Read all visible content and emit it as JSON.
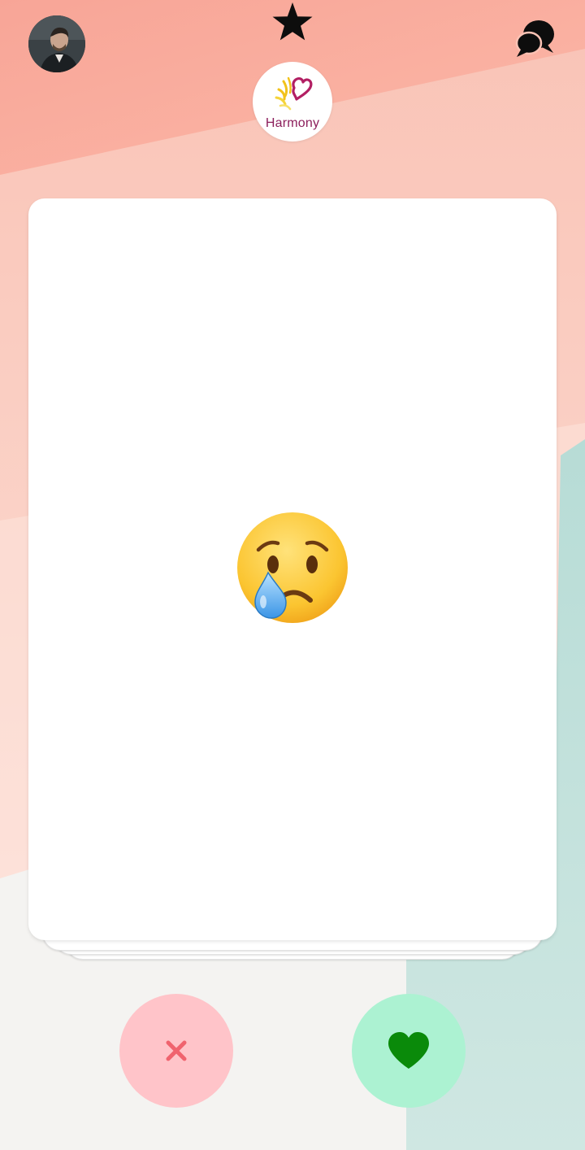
{
  "header": {
    "profile_avatar": "user-avatar",
    "favorites_icon": "star-icon",
    "messages_icon": "chat-bubbles-icon"
  },
  "logo": {
    "text": "Harmony"
  },
  "card": {
    "emoji": "crying-face-emoji"
  },
  "actions": {
    "dislike_icon": "close-icon",
    "like_icon": "heart-icon"
  },
  "colors": {
    "dislike_bg": "#ffc4c9",
    "dislike_icon": "#f0636e",
    "like_bg": "#acf2d2",
    "like_icon": "#0a8a0a",
    "brand": "#8c1f5c"
  }
}
